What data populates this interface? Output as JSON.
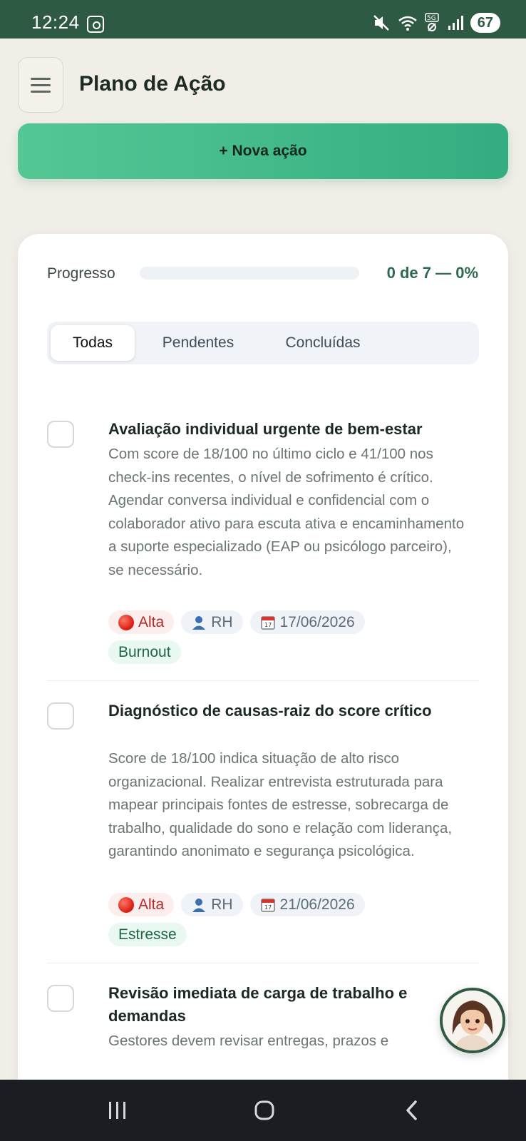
{
  "status_bar": {
    "time": "12:24",
    "battery": "67"
  },
  "header": {
    "title": "Plano de Ação",
    "new_action_label": "+ Nova ação"
  },
  "progress": {
    "label": "Progresso",
    "text": "0 de 7 — 0%",
    "fraction": 0
  },
  "tabs": [
    {
      "label": "Todas",
      "active": true
    },
    {
      "label": "Pendentes",
      "active": false
    },
    {
      "label": "Concluídas",
      "active": false
    }
  ],
  "actions": [
    {
      "title": "Avaliação individual urgente de bem-estar",
      "description": "Com score de 18/100 no último ciclo e 41/100 nos check-ins recentes, o nível de sofrimento é crítico. Agendar conversa individual e confidencial com o colaborador ativo para escuta ativa e encaminhamento a suporte especializado (EAP ou psicólogo parceiro), se necessário.",
      "priority": "Alta",
      "owner": "RH",
      "date": "17/06/2026",
      "tag": "Burnout"
    },
    {
      "title": "Diagnóstico de causas-raiz do score crítico",
      "description": "Score de 18/100 indica situação de alto risco organizacional. Realizar entrevista estruturada para mapear principais fontes de estresse, sobrecarga de trabalho, qualidade do sono e relação com liderança, garantindo anonimato e segurança psicológica.",
      "priority": "Alta",
      "owner": "RH",
      "date": "21/06/2026",
      "tag": "Estresse"
    },
    {
      "title": "Revisão imediata de carga de trabalho e demandas",
      "description": "Gestores devem revisar entregas, prazos e"
    }
  ],
  "icons": {
    "menu": "hamburger-icon",
    "priority": "red-circle-icon",
    "owner": "person-icon",
    "date": "calendar-icon",
    "assistant": "assistant-avatar-icon"
  },
  "colors": {
    "brand": "#2e5a44",
    "accent": "#3bb483",
    "priority_high": "#b52828"
  }
}
